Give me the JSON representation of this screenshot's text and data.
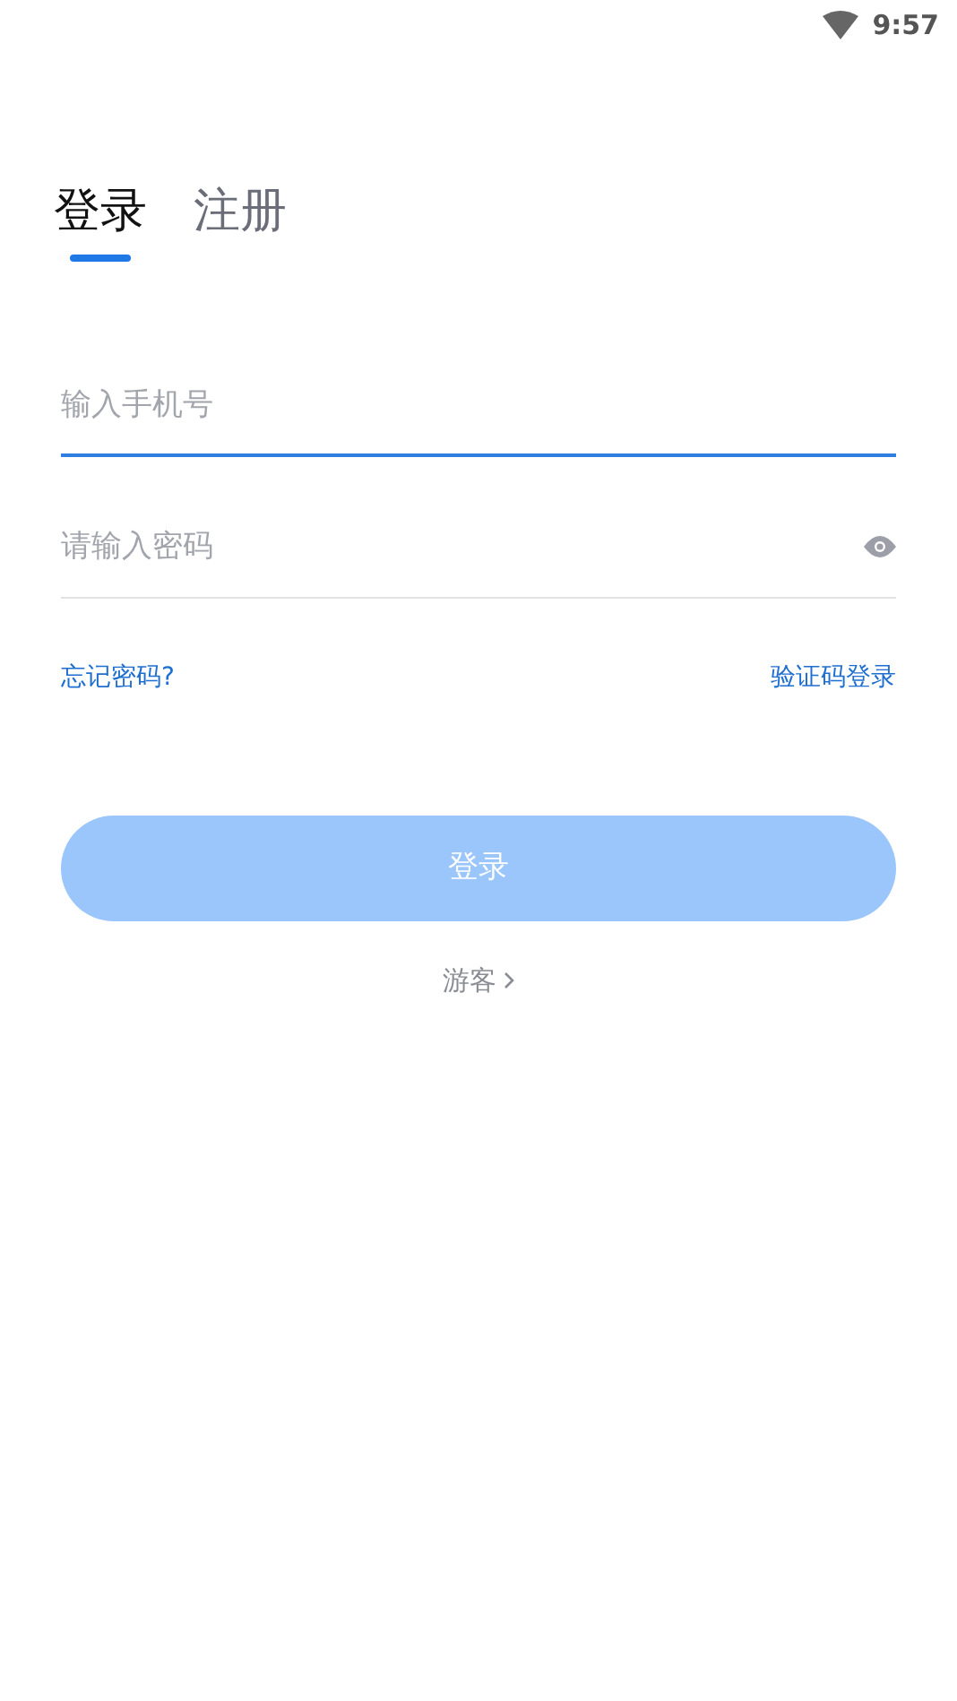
{
  "status_bar": {
    "time": "9:57"
  },
  "tabs": [
    {
      "label": "登录",
      "selected": true
    },
    {
      "label": "注册",
      "selected": false
    }
  ],
  "fields": [
    {
      "kind": "text",
      "placeholder": "输入手机号",
      "focused": true
    },
    {
      "kind": "password",
      "placeholder": "请输入密码",
      "focused": false
    }
  ],
  "links": [
    "忘记密码?",
    "验证码登录"
  ],
  "login_button": {
    "label": "登录",
    "disabled": true
  },
  "guest_link": {
    "label": "游客"
  }
}
